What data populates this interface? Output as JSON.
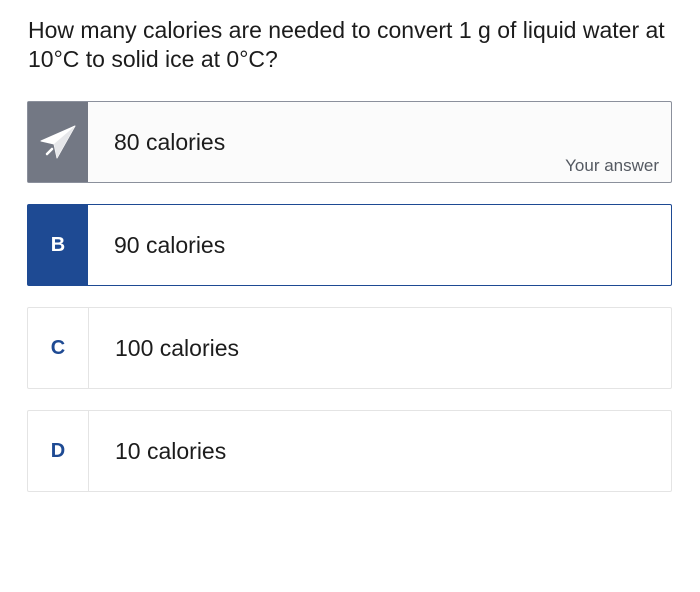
{
  "question": "How many calories are needed to convert 1 g of liquid water at 10°C to solid ice at 0°C?",
  "options": [
    {
      "badge_icon": "paper-plane-icon",
      "label": "80 calories",
      "note": "Your answer",
      "selected": true
    },
    {
      "badge": "B",
      "label": "90 calories",
      "correct": true
    },
    {
      "badge": "C",
      "label": "100 calories"
    },
    {
      "badge": "D",
      "label": "10 calories"
    }
  ],
  "colors": {
    "selected_badge": "#737884",
    "correct_accent": "#1e4a93",
    "border": "#e4e4e4"
  }
}
